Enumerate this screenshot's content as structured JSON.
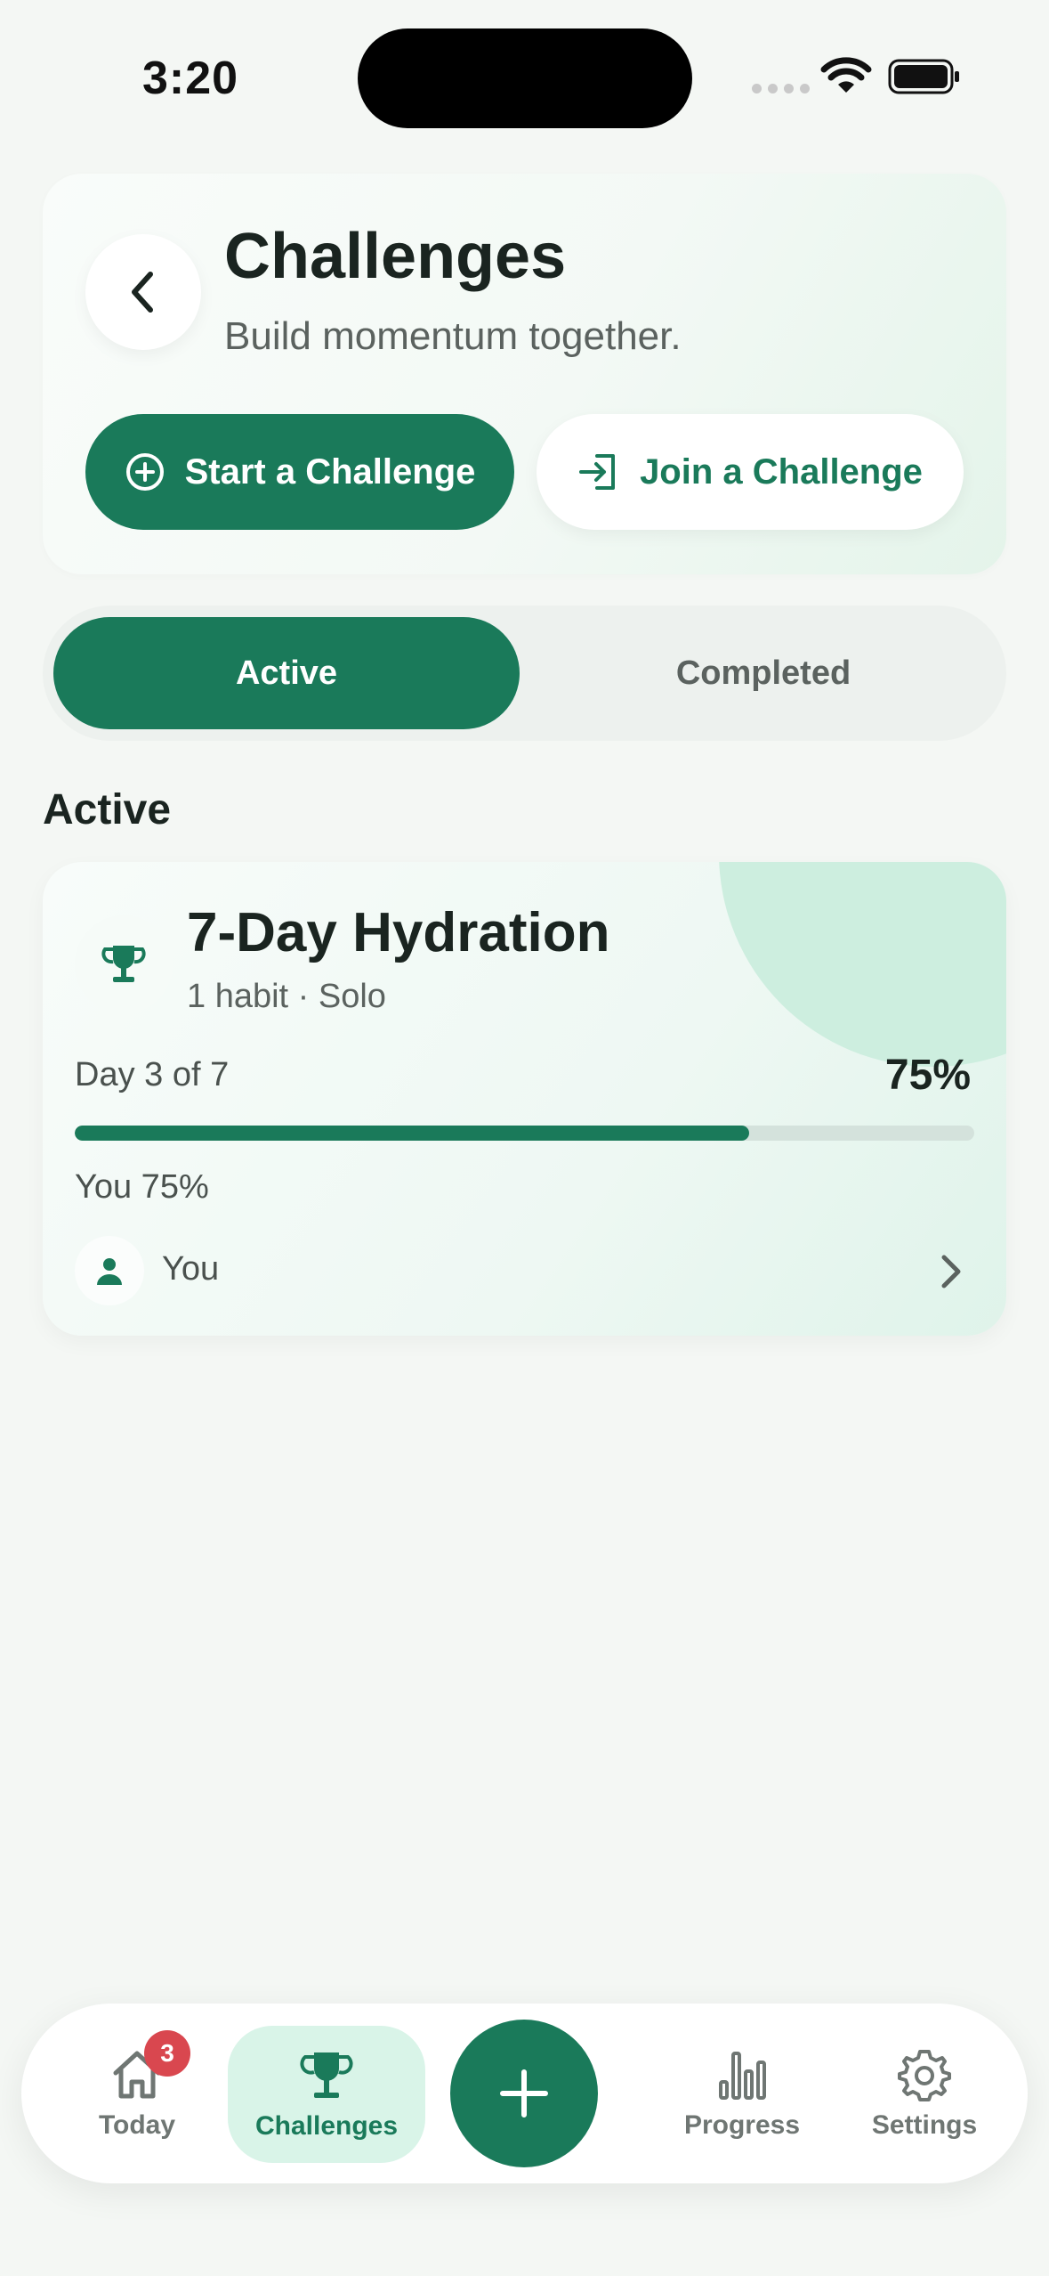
{
  "status_bar": {
    "time": "3:20"
  },
  "header": {
    "title": "Challenges",
    "subtitle": "Build momentum together.",
    "start_label": "Start a Challenge",
    "join_label": "Join a Challenge"
  },
  "segments": {
    "active_label": "Active",
    "completed_label": "Completed",
    "selected": "Active"
  },
  "section": {
    "title": "Active"
  },
  "challenge": {
    "name": "7-Day Hydration",
    "meta": "1 habit · Solo",
    "day_label": "Day 3 of 7",
    "percent_label": "75%",
    "progress_fraction": 0.75,
    "you_label": "You 75%",
    "member_name": "You"
  },
  "tab_bar": {
    "today": "Today",
    "today_badge": "3",
    "challenges": "Challenges",
    "progress": "Progress",
    "settings": "Settings",
    "selected": "Challenges"
  },
  "colors": {
    "accent": "#1a7a5a",
    "badge": "#d9474f",
    "background": "#f4f7f4"
  },
  "icons": {
    "back": "chevron-left-icon",
    "start": "plus-circle-icon",
    "join": "sign-in-icon",
    "trophy": "trophy-icon",
    "member": "person-icon",
    "chevron": "chevron-right-icon",
    "today": "home-icon",
    "challenges": "trophy-icon",
    "add": "plus-icon",
    "progress": "bar-chart-icon",
    "settings": "gear-icon"
  }
}
